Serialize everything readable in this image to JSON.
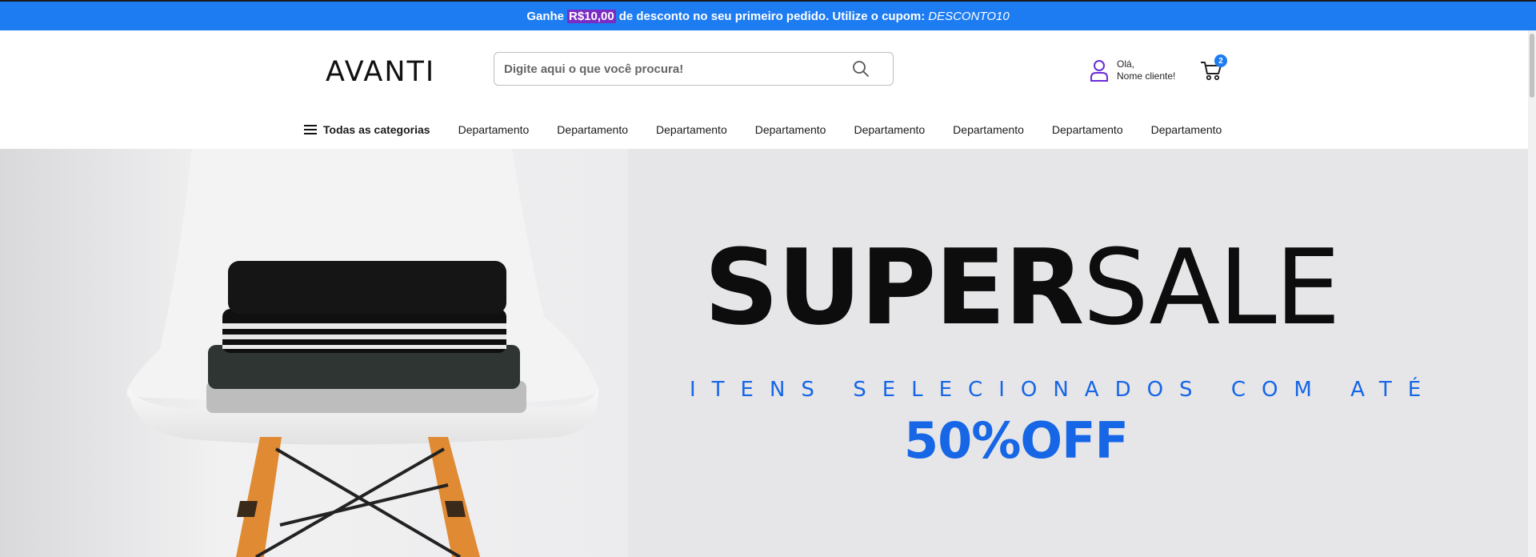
{
  "promo": {
    "prefix": "Ganhe",
    "amount": "R$10,00",
    "middle": "de desconto no seu primeiro pedido. Utilize o cupom:",
    "coupon": "DESCONTO10"
  },
  "header": {
    "logo_text": "AVANTI",
    "search_placeholder": "Digite aqui o que você procura!",
    "account_greeting": "Olá,",
    "account_name": "Nome cliente!",
    "cart_count": "2"
  },
  "nav": {
    "all_categories": "Todas as categorias",
    "departments": [
      "Departamento",
      "Departamento",
      "Departamento",
      "Departamento",
      "Departamento",
      "Departamento",
      "Departamento",
      "Departamento"
    ]
  },
  "hero": {
    "title_bold": "SUPER",
    "title_light": "SALE",
    "subtitle": "ITENS SELECIONADOS COM ATÉ",
    "discount": "50%OFF"
  },
  "colors": {
    "promo_bar": "#1d7cf2",
    "accent_blue": "#1666e6",
    "highlight_purple": "#7b2cc4",
    "account_icon": "#6a2cd8"
  },
  "icons": {
    "search": "search-icon",
    "user": "user-icon",
    "cart": "cart-icon",
    "menu": "hamburger-icon"
  }
}
